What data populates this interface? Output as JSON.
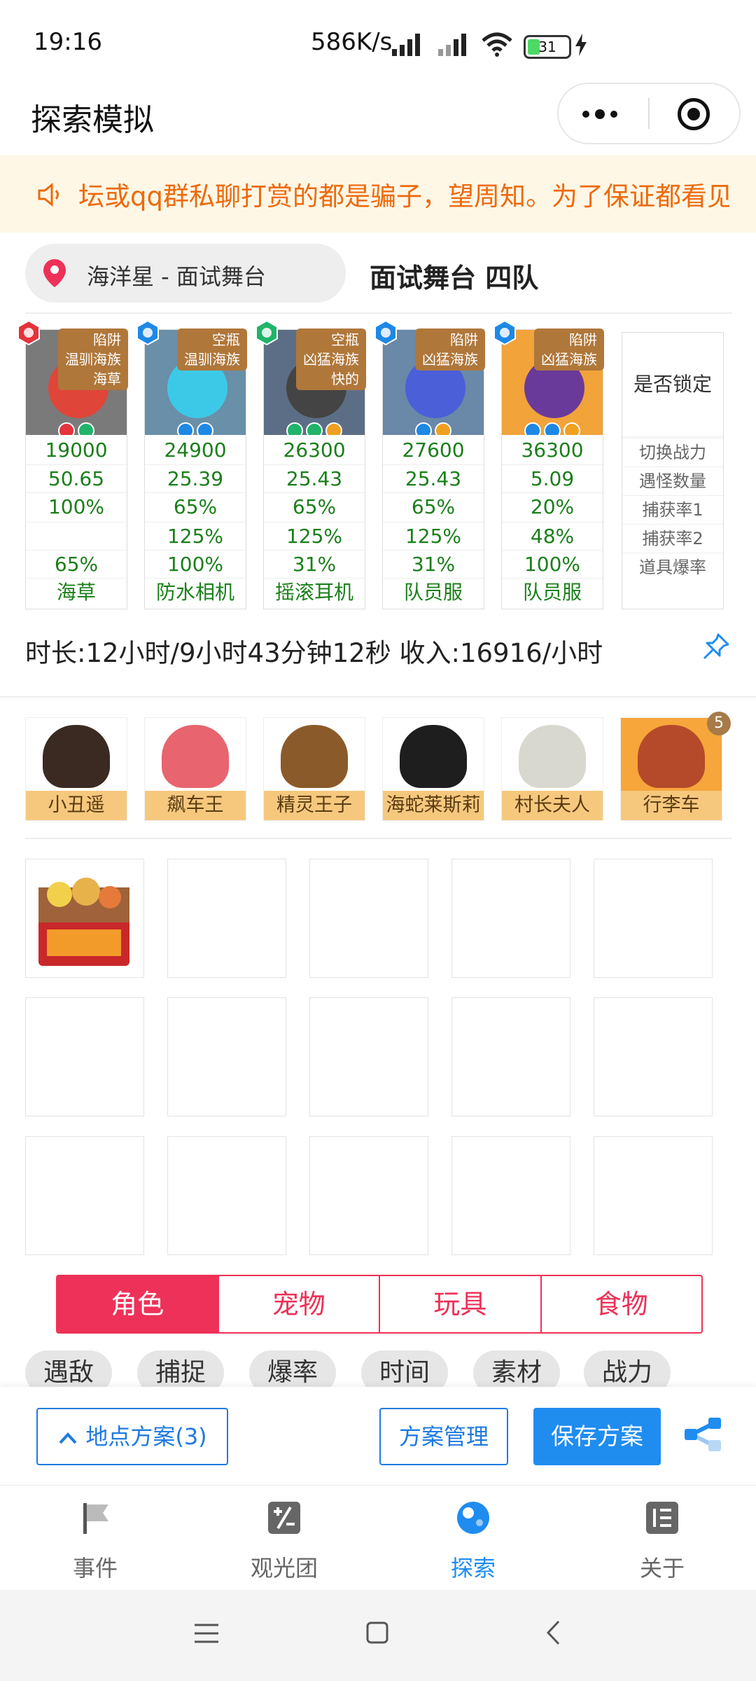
{
  "status_bar": {
    "time": "19:16",
    "network_speed": "586K/s",
    "battery": "31",
    "battery_level": 0.31
  },
  "header": {
    "title": "探索模拟"
  },
  "notice": {
    "text": "坛或qq群私聊打赏的都是骗子，望周知。为了保证都看见"
  },
  "location": {
    "name": "海洋星 - 面试舞台",
    "team": "面试舞台 四队"
  },
  "team": [
    {
      "tag": [
        "陷阱",
        "温驯海族",
        "海草"
      ],
      "element": "fire",
      "element_color": "#e5333b",
      "body_color": "#e0453a",
      "bg": "#7a7a7a",
      "chips": [
        "#e5333b",
        "#20b46a"
      ],
      "power": "19000",
      "encounters": "50.65",
      "capture1": "100%",
      "capture2": "",
      "drop": "65%",
      "item": "海草"
    },
    {
      "tag": [
        "空瓶",
        "温驯海族"
      ],
      "element": "water",
      "element_color": "#1e88e5",
      "body_color": "#3cc9e8",
      "bg": "#6a8fa8",
      "chips": [
        "#1e88e5",
        "#1e88e5"
      ],
      "power": "24900",
      "encounters": "25.39",
      "capture1": "65%",
      "capture2": "125%",
      "drop": "100%",
      "item": "防水相机"
    },
    {
      "tag": [
        "空瓶",
        "凶猛海族",
        "快的"
      ],
      "element": "nature",
      "element_color": "#20b46a",
      "body_color": "#444444",
      "bg": "#5c6e86",
      "chips": [
        "#20b46a",
        "#20b46a",
        "#f0a020"
      ],
      "power": "26300",
      "encounters": "25.43",
      "capture1": "65%",
      "capture2": "125%",
      "drop": "31%",
      "item": "摇滚耳机"
    },
    {
      "tag": [
        "陷阱",
        "凶猛海族"
      ],
      "element": "water",
      "element_color": "#1e88e5",
      "body_color": "#4a5fd8",
      "bg": "#6a88a8",
      "chips": [
        "#1e88e5",
        "#f0a020"
      ],
      "power": "27600",
      "encounters": "25.43",
      "capture1": "65%",
      "capture2": "125%",
      "drop": "31%",
      "item": "队员服"
    },
    {
      "tag": [
        "陷阱",
        "凶猛海族"
      ],
      "element": "water",
      "element_color": "#1e88e5",
      "body_color": "#6a3a9a",
      "bg": "#f2a33a",
      "chips": [
        "#1e88e5",
        "#1e88e5",
        "#f0a020"
      ],
      "power": "36300",
      "encounters": "5.09",
      "capture1": "20%",
      "capture2": "48%",
      "drop": "100%",
      "item": "队员服"
    }
  ],
  "lock_card": {
    "title": "是否锁定",
    "rows": [
      "切换战力",
      "遇怪数量",
      "捕获率1",
      "捕获率2",
      "道具爆率"
    ]
  },
  "time_info": "时长:12小时/9小时43分钟12秒 收入:16916/小时",
  "members": [
    {
      "name": "小丑遥",
      "color": "#3b2a22"
    },
    {
      "name": "飙车王",
      "color": "#e8646e"
    },
    {
      "name": "精灵王子",
      "color": "#8a5a2a"
    },
    {
      "name": "海蛇莱斯莉",
      "color": "#1e1e1e"
    },
    {
      "name": "村长夫人",
      "color": "#d8d8d0"
    },
    {
      "name": "行李车",
      "color": "#b54a2a",
      "badge": "5"
    }
  ],
  "tabs": [
    {
      "label": "角色",
      "active": true
    },
    {
      "label": "宠物",
      "active": false
    },
    {
      "label": "玩具",
      "active": false
    },
    {
      "label": "食物",
      "active": false
    }
  ],
  "filters": [
    "遇敌",
    "捕捉",
    "爆率",
    "时间",
    "素材",
    "战力"
  ],
  "actions": {
    "location_plans": "地点方案(3)",
    "manage": "方案管理",
    "save": "保存方案"
  },
  "nav": [
    {
      "label": "事件",
      "icon": "flag-icon",
      "active": false
    },
    {
      "label": "观光团",
      "icon": "calculator-icon",
      "active": false
    },
    {
      "label": "探索",
      "icon": "planet-icon",
      "active": true
    },
    {
      "label": "关于",
      "icon": "list-icon",
      "active": false
    }
  ],
  "colors": {
    "accent": "#1f8cf0",
    "tab_accent": "#ee3158",
    "notice": "#ed6a0c",
    "stat": "#1a7f1a"
  }
}
